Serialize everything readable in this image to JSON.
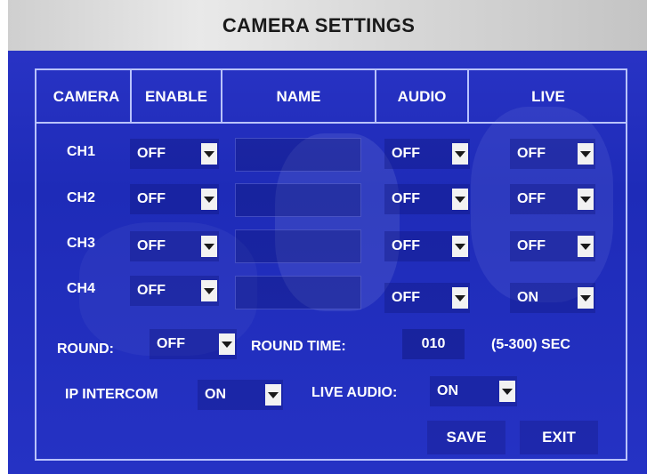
{
  "title": "CAMERA SETTINGS",
  "columns": [
    "CAMERA",
    "ENABLE",
    "NAME",
    "AUDIO",
    "LIVE"
  ],
  "channels": [
    {
      "label": "CH1",
      "enable": "OFF",
      "audio": "OFF",
      "live": "OFF"
    },
    {
      "label": "CH2",
      "enable": "OFF",
      "audio": "OFF",
      "live": "OFF"
    },
    {
      "label": "CH3",
      "enable": "OFF",
      "audio": "OFF",
      "live": "OFF"
    },
    {
      "label": "CH4",
      "enable": "OFF",
      "audio": "OFF",
      "live": "ON"
    }
  ],
  "round": {
    "label": "ROUND:",
    "value": "OFF"
  },
  "round_time": {
    "label": "ROUND TIME:",
    "value": "010",
    "range": "(5-300) SEC"
  },
  "ip_intercom": {
    "label": "IP INTERCOM",
    "value": "ON"
  },
  "live_audio": {
    "label": "LIVE AUDIO:",
    "value": "ON"
  },
  "buttons": {
    "save": "SAVE",
    "exit": "EXIT"
  },
  "colors": {
    "panel": "#1e2bb8",
    "border": "#b9c3ff",
    "text": "#ffffff",
    "title_bar": "#e0e0e0"
  },
  "icons": {
    "dropdown": "dropdown-arrow-icon"
  }
}
